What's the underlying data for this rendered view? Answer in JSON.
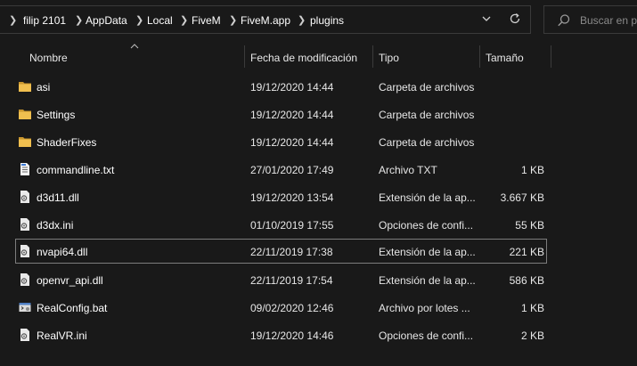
{
  "breadcrumb": [
    "filip 2101",
    "AppData",
    "Local",
    "FiveM",
    "FiveM.app",
    "plugins"
  ],
  "search": {
    "placeholder": "Buscar en pl"
  },
  "columns": {
    "name": "Nombre",
    "date": "Fecha de modificación",
    "type": "Tipo",
    "size": "Tamaño"
  },
  "files": [
    {
      "name": "asi",
      "date": "19/12/2020 14:44",
      "type": "Carpeta de archivos",
      "size": "",
      "icon": "folder-icon"
    },
    {
      "name": "Settings",
      "date": "19/12/2020 14:44",
      "type": "Carpeta de archivos",
      "size": "",
      "icon": "folder-icon"
    },
    {
      "name": "ShaderFixes",
      "date": "19/12/2020 14:44",
      "type": "Carpeta de archivos",
      "size": "",
      "icon": "folder-icon"
    },
    {
      "name": "commandline.txt",
      "date": "27/01/2020 17:49",
      "type": "Archivo TXT",
      "size": "1 KB",
      "icon": "text-file-icon"
    },
    {
      "name": "d3d11.dll",
      "date": "19/12/2020 13:54",
      "type": "Extensión de la ap...",
      "size": "3.667 KB",
      "icon": "dll-file-icon"
    },
    {
      "name": "d3dx.ini",
      "date": "01/10/2019 17:55",
      "type": "Opciones de confi...",
      "size": "55 KB",
      "icon": "ini-file-icon"
    },
    {
      "name": "nvapi64.dll",
      "date": "22/11/2019 17:38",
      "type": "Extensión de la ap...",
      "size": "221 KB",
      "icon": "dll-file-icon"
    },
    {
      "name": "openvr_api.dll",
      "date": "22/11/2019 17:54",
      "type": "Extensión de la ap...",
      "size": "586 KB",
      "icon": "dll-file-icon"
    },
    {
      "name": "RealConfig.bat",
      "date": "09/02/2020 12:46",
      "type": "Archivo por lotes ...",
      "size": "1 KB",
      "icon": "batch-file-icon"
    },
    {
      "name": "RealVR.ini",
      "date": "19/12/2020 14:46",
      "type": "Opciones de confi...",
      "size": "2 KB",
      "icon": "ini-file-icon"
    }
  ],
  "selected_index": 6,
  "colors": {
    "background": "#191919",
    "folder": "#e8b44a",
    "selection_border": "#7d7d7d"
  }
}
